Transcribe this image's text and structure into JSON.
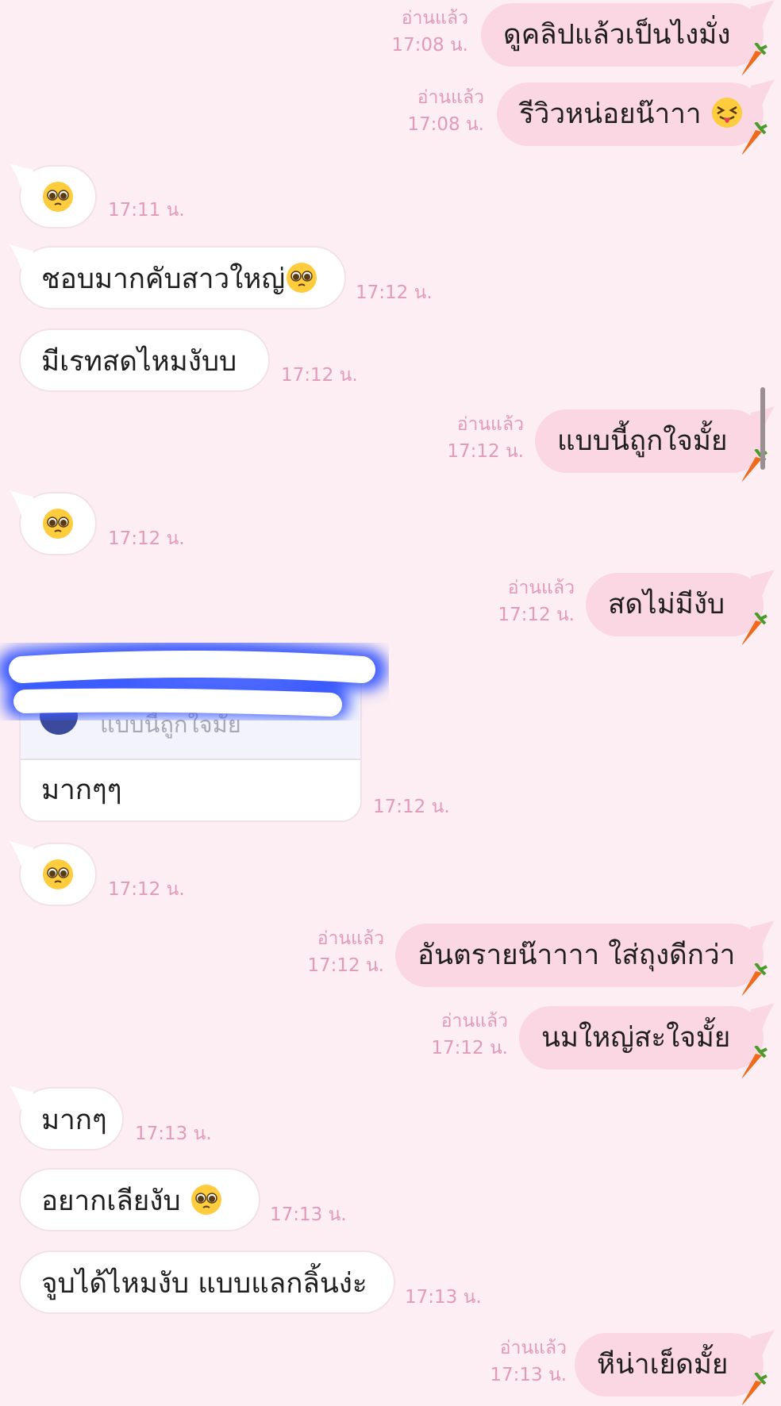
{
  "colors": {
    "background": "#fdeef3",
    "incoming_bubble": "#ffffff",
    "outgoing_bubble": "#fbd7e3",
    "meta_text": "#e39aba",
    "redaction": "#3d5cff"
  },
  "messages": [
    {
      "dir": "out",
      "text": "ดูคลิปแล้วเป็นไงมั่ง",
      "emoji": "",
      "read": "อ่านแล้ว",
      "time": "17:08 น."
    },
    {
      "dir": "out",
      "text": "รีวิวหน่อยน๊าาา",
      "emoji": "squinting-tongue",
      "read": "อ่านแล้ว",
      "time": "17:08 น."
    },
    {
      "dir": "in",
      "text": "",
      "emoji": "pleading-face",
      "time": "17:11 น."
    },
    {
      "dir": "in",
      "text": "ชอบมากคับสาวใหญ่",
      "emoji": "pleading-face",
      "time": "17:12 น."
    },
    {
      "dir": "in",
      "text": "มีเรทสดไหมงับบ",
      "emoji": "",
      "time": "17:12 น."
    },
    {
      "dir": "out",
      "text": "แบบนี้ถูกใจมั้ย",
      "emoji": "",
      "read": "อ่านแล้ว",
      "time": "17:12 น."
    },
    {
      "dir": "in",
      "text": "",
      "emoji": "pleading-face",
      "time": "17:12 น."
    },
    {
      "dir": "out",
      "text": "สดไม่มีงับ",
      "emoji": "",
      "read": "อ่านแล้ว",
      "time": "17:12 น."
    },
    {
      "dir": "in",
      "text": "",
      "emoji": "pleading-face",
      "time": "17:12 น."
    },
    {
      "dir": "out",
      "text": "อันตรายน๊าาาา ใส่ถุงดีกว่า",
      "emoji": "",
      "read": "อ่านแล้ว",
      "time": "17:12 น."
    },
    {
      "dir": "out",
      "text": "นมใหญ่สะใจมั้ย",
      "emoji": "",
      "read": "อ่านแล้ว",
      "time": "17:12 น."
    },
    {
      "dir": "in",
      "text": "มากๆ",
      "emoji": "",
      "time": "17:13 น."
    },
    {
      "dir": "in",
      "text": "อยากเลียงับ ",
      "emoji": "pleading-face",
      "time": "17:13 น."
    },
    {
      "dir": "in",
      "text": "จูบได้ไหมงับ แบบแลกลิ้นง่ะ",
      "emoji": "",
      "time": "17:13 น."
    },
    {
      "dir": "out",
      "text": "หีน่าเย็ดมั้ย",
      "emoji": "",
      "read": "อ่านแล้ว",
      "time": "17:13 น."
    }
  ],
  "reply_message": {
    "quoted_text": "แบบนี้ถูกใจมั้ย",
    "text": "มากๆๆ",
    "time": "17:12 น."
  }
}
